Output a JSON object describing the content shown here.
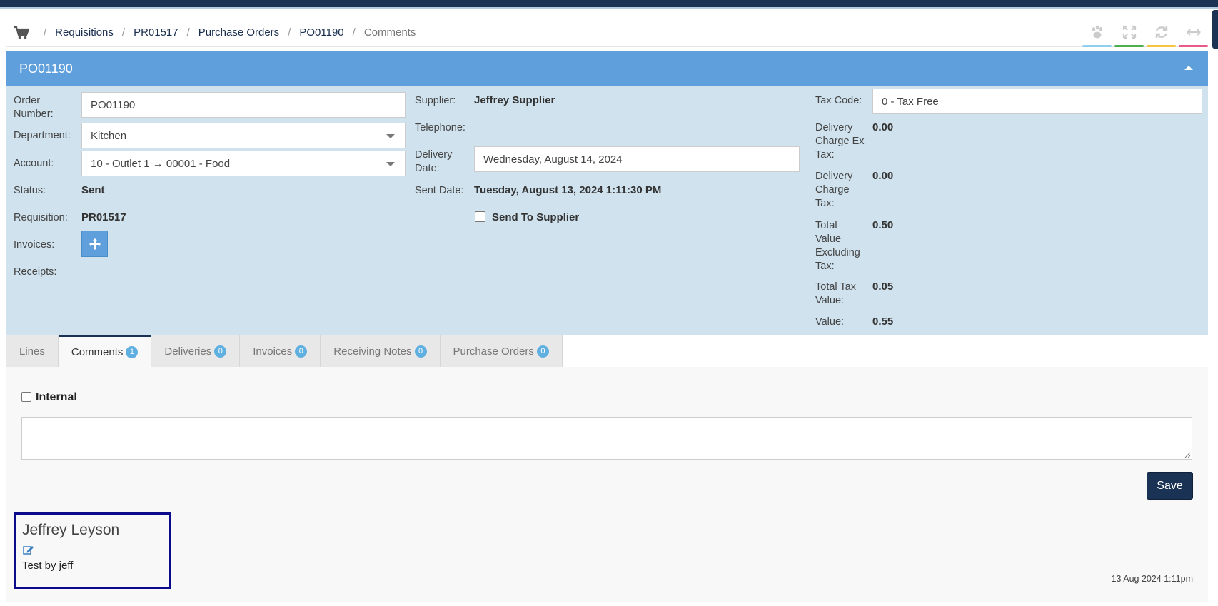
{
  "breadcrumb": {
    "items": [
      "Requisitions",
      "PR01517",
      "Purchase Orders",
      "PO01190"
    ],
    "current": "Comments",
    "separator": "/"
  },
  "toolbar": {
    "icons": [
      "paw-icon",
      "expand-icon",
      "refresh-icon",
      "resize-horizontal-icon"
    ],
    "accent_colors": [
      "#8fd0f0",
      "#4caf50",
      "#f5c542",
      "#e85a8a"
    ]
  },
  "panel": {
    "title": "PO01190"
  },
  "order": {
    "order_number_label": "Order Number:",
    "order_number": "PO01190",
    "department_label": "Department:",
    "department": "Kitchen",
    "account_label": "Account:",
    "account": "10 - Outlet 1 → 00001 - Food",
    "status_label": "Status:",
    "status": "Sent",
    "requisition_label": "Requisition:",
    "requisition": "PR01517",
    "invoices_label": "Invoices:",
    "receipts_label": "Receipts:"
  },
  "supplier": {
    "supplier_label": "Supplier:",
    "supplier": "Jeffrey Supplier",
    "telephone_label": "Telephone:",
    "delivery_date_label": "Delivery Date:",
    "delivery_date": "Wednesday, August 14, 2024",
    "sent_date_label": "Sent Date:",
    "sent_date": "Tuesday, August 13, 2024 1:11:30 PM",
    "send_to_supplier_label": "Send To Supplier"
  },
  "totals": {
    "tax_code_label": "Tax Code:",
    "tax_code": "0 - Tax Free",
    "delivery_ex_tax_label": "Delivery Charge Ex Tax:",
    "delivery_ex_tax": "0.00",
    "delivery_tax_label": "Delivery Charge Tax:",
    "delivery_tax": "0.00",
    "total_ex_tax_label": "Total Value Excluding Tax:",
    "total_ex_tax": "0.50",
    "total_tax_label": "Total Tax Value:",
    "total_tax": "0.05",
    "value_label": "Value:",
    "value": "0.55"
  },
  "tabs": [
    {
      "label": "Lines",
      "badge": null
    },
    {
      "label": "Comments",
      "badge": "1"
    },
    {
      "label": "Deliveries",
      "badge": "0"
    },
    {
      "label": "Invoices",
      "badge": "0"
    },
    {
      "label": "Receiving Notes",
      "badge": "0"
    },
    {
      "label": "Purchase Orders",
      "badge": "0"
    }
  ],
  "comments": {
    "internal_label": "Internal",
    "save_label": "Save",
    "entries": [
      {
        "author": "Jeffrey Leyson",
        "text": "Test by jeff",
        "time": "13 Aug 2024 1:11pm"
      }
    ]
  },
  "colors": {
    "header_blue": "#5fa0dc",
    "panel_bg": "#cfe2ee",
    "navy": "#1a3355"
  }
}
